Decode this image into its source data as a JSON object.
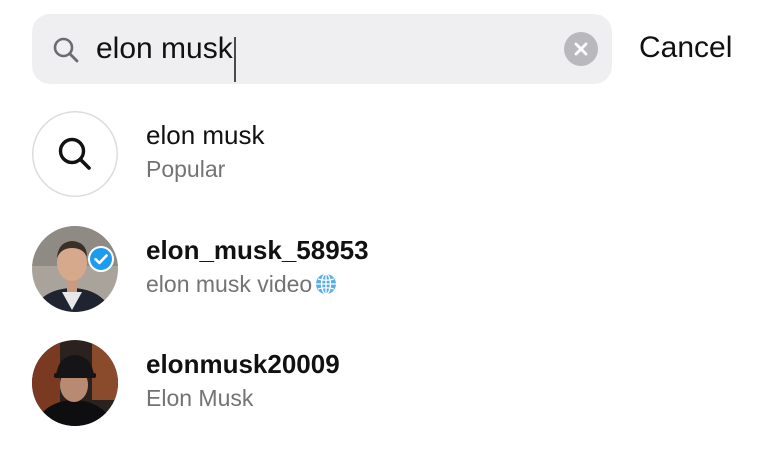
{
  "search": {
    "value": "elon musk",
    "clear_icon": "x-circle-icon",
    "search_icon": "magnifier-icon",
    "cancel_label": "Cancel"
  },
  "results": [
    {
      "title": "elon musk",
      "subtitle": "Popular",
      "icon": "search-icon"
    },
    {
      "title": "elon_musk_58953",
      "subtitle": "elon musk video",
      "verified": true,
      "subtitle_icon": "globe-icon"
    },
    {
      "title": "elonmusk20009",
      "subtitle": "Elon Musk"
    }
  ],
  "colors": {
    "search_bg": "#efeff1",
    "secondary_text": "#737373",
    "verified_blue": "#1d9bf0",
    "clear_button": "#b8b8bd"
  }
}
